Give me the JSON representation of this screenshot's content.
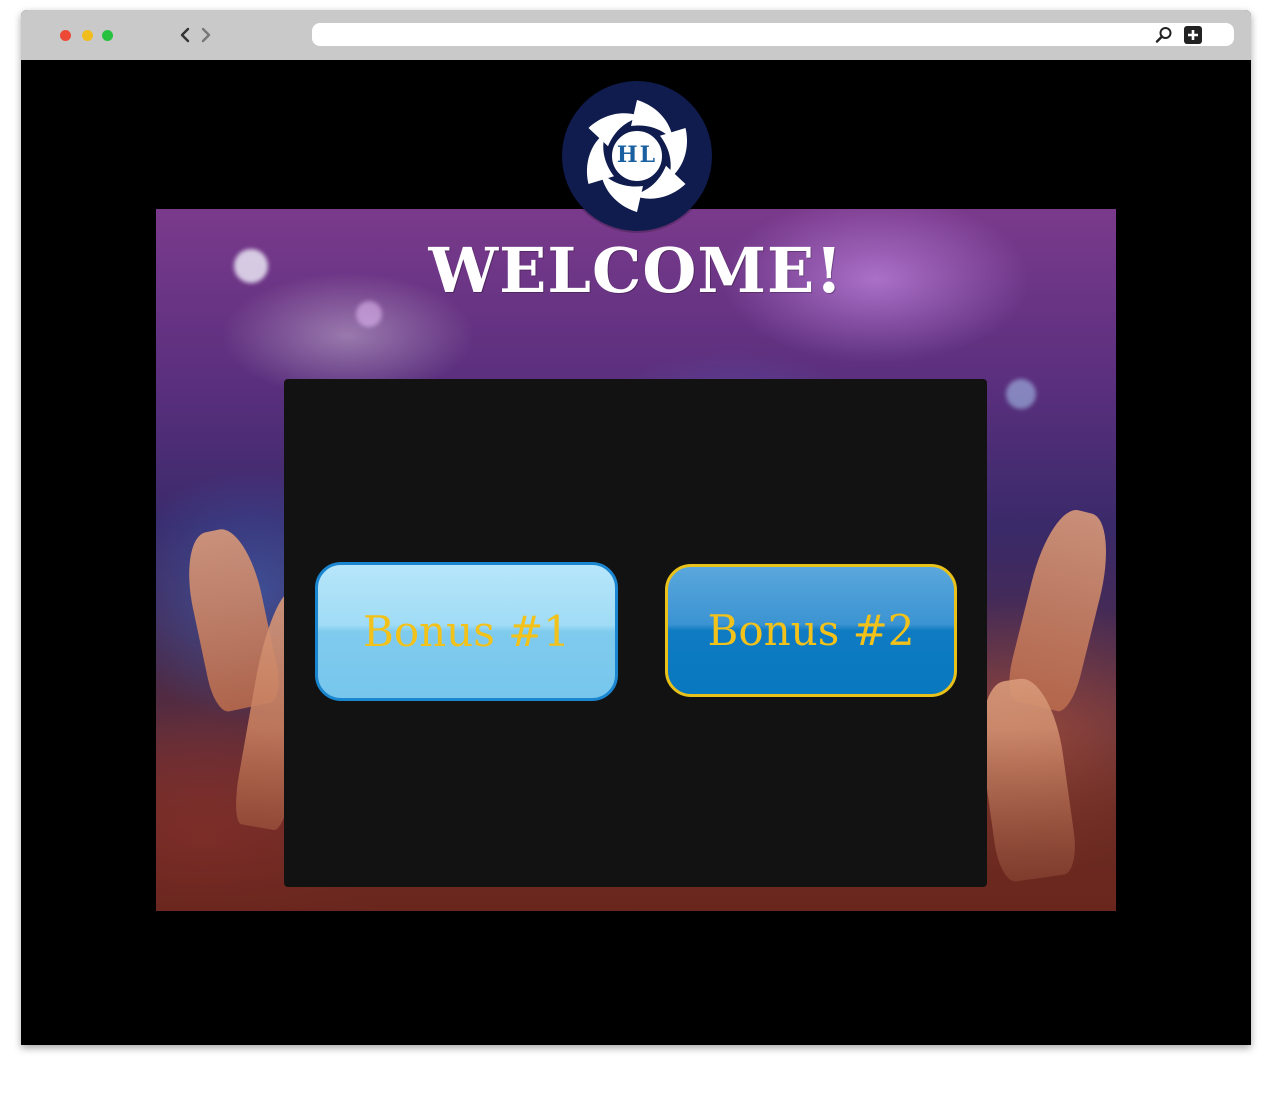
{
  "page": {
    "welcome_title": "WELCOME!",
    "logo_text": "HL"
  },
  "buttons": {
    "bonus_1_label": "Bonus #1",
    "bonus_2_label": "Bonus #2"
  },
  "colors": {
    "button_text": "#f2c21b",
    "bonus_1_border": "#1b86d0",
    "bonus_2_border": "#e8c21b",
    "panel_background": "#121212",
    "logo_background": "#0f1c4d"
  },
  "icons": {
    "traffic_lights": [
      "close-dot",
      "minimize-dot",
      "maximize-dot"
    ],
    "navigation": [
      "chevron-left-icon",
      "chevron-right-icon"
    ],
    "address_bar": [
      "search-icon",
      "new-tab-icon"
    ]
  }
}
